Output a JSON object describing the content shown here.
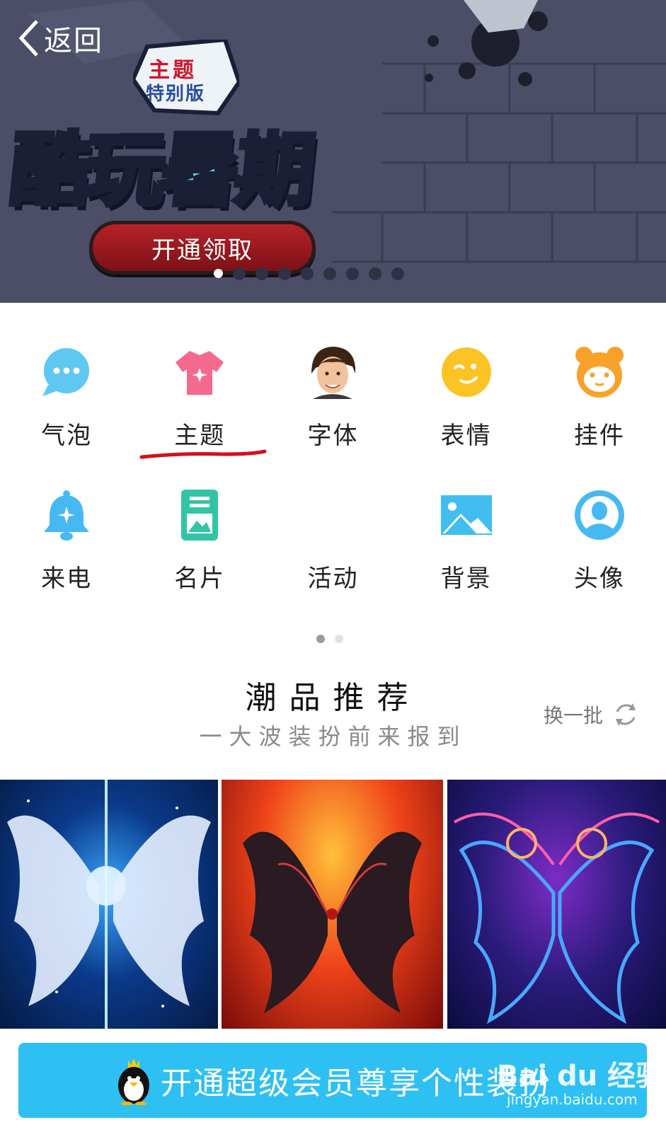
{
  "header": {
    "back_label": "返回"
  },
  "banner": {
    "badge_top": "主题",
    "badge_bottom": "特别版",
    "title": "酷玩暑期",
    "cta_label": "开通领取",
    "slide_count": 9,
    "active_slide": 1
  },
  "categories": [
    {
      "label": "气泡",
      "icon": "speech-bubble-icon",
      "color": "#5ec8f0"
    },
    {
      "label": "主题",
      "icon": "tshirt-icon",
      "color": "#f46a8e"
    },
    {
      "label": "字体",
      "icon": "avatar-photo-icon",
      "color": "#c98a5d"
    },
    {
      "label": "表情",
      "icon": "smiley-icon",
      "color": "#fbc324"
    },
    {
      "label": "挂件",
      "icon": "bear-face-icon",
      "color": "#f8a22a"
    },
    {
      "label": "来电",
      "icon": "bell-icon",
      "color": "#47b9f2"
    },
    {
      "label": "名片",
      "icon": "card-icon",
      "color": "#33c4a6"
    },
    {
      "label": "活动",
      "icon": "",
      "color": ""
    },
    {
      "label": "背景",
      "icon": "picture-icon",
      "color": "#41bdf0"
    },
    {
      "label": "头像",
      "icon": "user-avatar-icon",
      "color": "#47b9f2"
    }
  ],
  "grid_pages": {
    "count": 2,
    "active": 1
  },
  "section": {
    "title": "潮品推荐",
    "subtitle": "一大波装扮前来报到",
    "refresh_label": "换一批"
  },
  "themes": [
    {
      "icon": "white-wings-icon"
    },
    {
      "icon": "dark-wings-icon"
    },
    {
      "icon": "neon-wings-icon"
    }
  ],
  "vip_bar": {
    "label": "开通超级会员尊享个性装扮"
  },
  "watermark": {
    "brand": "Bai du 经验",
    "url": "jingyan.baidu.com"
  },
  "colors": {
    "accent": "#2ec0f2",
    "cta": "#b62229",
    "underline": "#d0121c"
  }
}
